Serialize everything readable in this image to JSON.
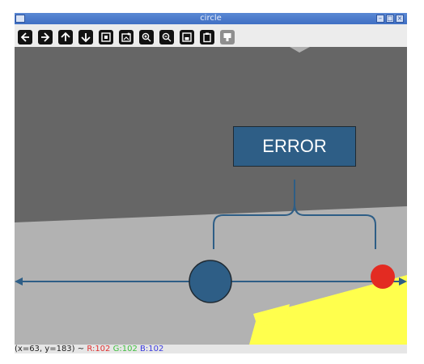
{
  "window": {
    "title": "circle"
  },
  "toolbar": {
    "buttons": [
      {
        "name": "pan-left",
        "icon": "arrow-left-icon"
      },
      {
        "name": "pan-right",
        "icon": "arrow-right-icon"
      },
      {
        "name": "pan-up",
        "icon": "arrow-up-icon"
      },
      {
        "name": "pan-down",
        "icon": "arrow-down-icon"
      },
      {
        "name": "zoom-reset",
        "icon": "image-icon"
      },
      {
        "name": "zoom-fit",
        "icon": "image-fit-icon"
      },
      {
        "name": "zoom-in",
        "icon": "zoom-in-icon"
      },
      {
        "name": "zoom-out",
        "icon": "zoom-out-icon"
      },
      {
        "name": "save",
        "icon": "save-icon"
      },
      {
        "name": "copy",
        "icon": "clipboard-icon"
      },
      {
        "name": "properties",
        "icon": "properties-icon",
        "disabled": true
      }
    ]
  },
  "status": {
    "coords": "(x=63, y=183) ~",
    "r": "R:102",
    "g": "G:102",
    "b": "B:102",
    "colors": {
      "r": "#e03030",
      "g": "#3fbf3f",
      "b": "#3a3adf"
    }
  },
  "annotation": {
    "label": "ERROR"
  },
  "colors": {
    "wall": "#666666",
    "floor": "#b2b2b2",
    "light": "#ffff4d",
    "arrow": "#2e5e86",
    "blue_circle": "#2e5e86",
    "red_circle": "#e32b22"
  }
}
